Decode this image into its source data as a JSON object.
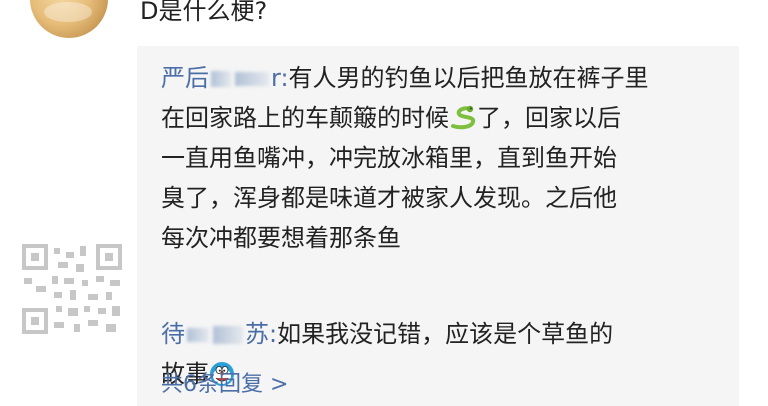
{
  "comment": {
    "text": "D是什么梗?"
  },
  "replies": [
    {
      "username": "严后",
      "username_suffix": "r",
      "separator": ":",
      "lines": [
        "有人男的钓鱼以后把鱼放在裤子里",
        "在回家路上的车颠簸的时候",
        "了，回家以后",
        "一直用鱼嘴冲，冲完放冰箱里，直到鱼开始",
        "臭了，浑身都是味道才被家人发现。之后他",
        "每次冲都要想着那条鱼"
      ],
      "emoji": "snake-emoji"
    },
    {
      "username": "待",
      "username_suffix": "苏",
      "separator": ":",
      "lines": [
        "如果我没记错，应该是个草鱼的",
        "故事"
      ],
      "emoji": "doraemon-face-emoji"
    }
  ],
  "more_replies": {
    "label": "共6条回复 >"
  },
  "colors": {
    "link": "#4c6ea7",
    "text": "#222222",
    "reply_bg": "#f5f5f5"
  }
}
